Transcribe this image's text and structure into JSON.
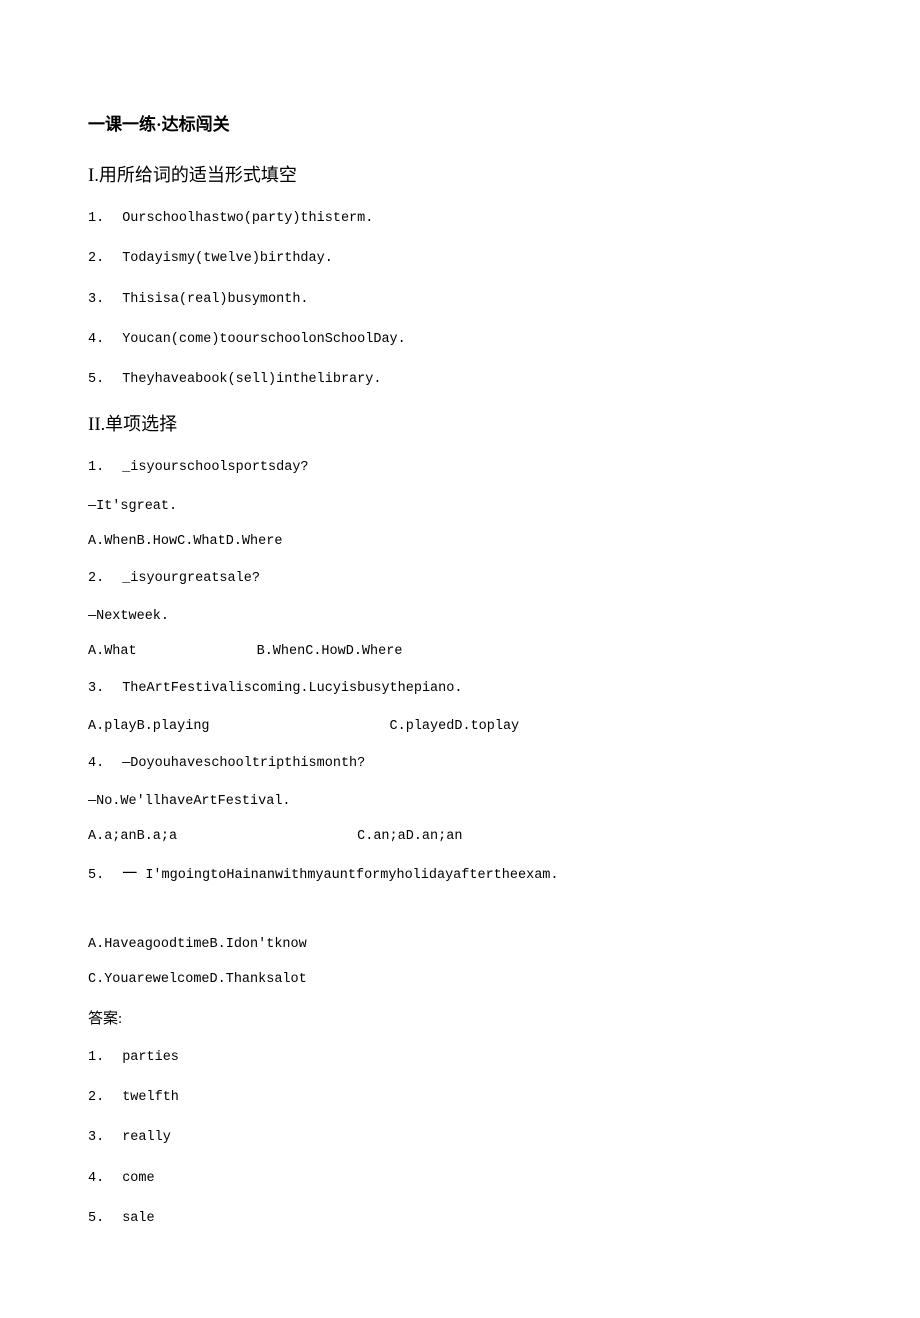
{
  "title": "一课一练·达标闯关",
  "section1": {
    "roman": "I",
    "heading": ".用所给词的适当形式填空",
    "items": [
      {
        "num": "1.",
        "text": "Ourschoolhastwo(party)thisterm."
      },
      {
        "num": "2.",
        "text": "Todayismy(twelve)birthday."
      },
      {
        "num": "3.",
        "text": "Thisisa(real)busymonth."
      },
      {
        "num": "4.",
        "text": "Youcan(come)toourschoolonSchoolDay."
      },
      {
        "num": "5.",
        "text": "Theyhaveabook(sell)inthelibrary."
      }
    ]
  },
  "section2": {
    "roman": "II",
    "heading": ".单项选择",
    "q1": {
      "num": "1.",
      "q": "_isyourschoolsportsday?",
      "line2": "—It'sgreat.",
      "opts": "A.WhenB.HowC.WhatD.Where"
    },
    "q2": {
      "num": "2.",
      "q": "_isyourgreatsale?",
      "line2": "—Nextweek.",
      "optsA": "A.What",
      "optsB": "B.WhenC.HowD.Where"
    },
    "q3": {
      "num": "3.",
      "q": "TheArtFestivaliscoming.Lucyisbusythepiano.",
      "optsA": "A.playB.playing",
      "optsB": "C.playedD.toplay"
    },
    "q4": {
      "num": "4.",
      "q": "—Doyouhaveschooltripthismonth?",
      "line2": "—No.We'llhaveArtFestival.",
      "optsA": "A.a;anB.a;a",
      "optsB": "C.an;aD.an;an"
    },
    "q5": {
      "num": "5.",
      "dash": "一",
      "q": "I'mgoingtoHainanwithmyauntformyholidayaftertheexam.",
      "optsLine1": "A.HaveagoodtimeB.Idon'tknow",
      "optsLine2": "C.YouarewelcomeD.Thanksalot"
    }
  },
  "answers": {
    "label": "答案:",
    "items": [
      {
        "num": "1.",
        "text": "parties"
      },
      {
        "num": "2.",
        "text": "twelfth"
      },
      {
        "num": "3.",
        "text": "really"
      },
      {
        "num": "4.",
        "text": "come"
      },
      {
        "num": "5.",
        "text": "sale"
      }
    ]
  }
}
